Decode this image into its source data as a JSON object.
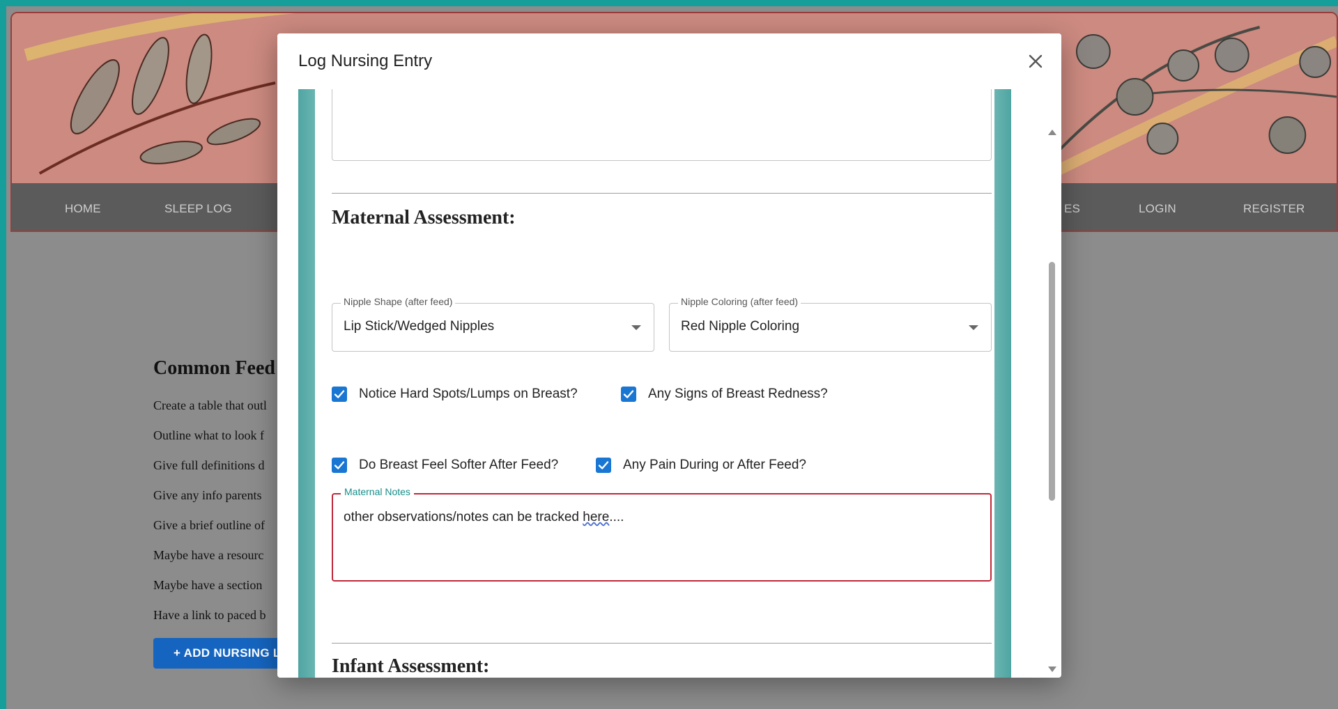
{
  "nav": {
    "items": [
      {
        "label": "HOME"
      },
      {
        "label": "SLEEP LOG"
      },
      {
        "label": "ES"
      },
      {
        "label": "LOGIN"
      },
      {
        "label": "REGISTER"
      }
    ]
  },
  "background_content": {
    "heading": "Common Feed",
    "lines": [
      "Create a table that outl",
      "Outline what to look f",
      "Give full definitions d",
      "Give any info parents",
      "Give a brief outline of",
      "Maybe have a resourc",
      "Maybe have a section",
      "Have a link to paced b"
    ],
    "add_button": "+ ADD NURSING LO"
  },
  "modal": {
    "title": "Log Nursing Entry",
    "maternal": {
      "title": "Maternal Assessment:",
      "nipple_shape": {
        "label": "Nipple Shape (after feed)",
        "value": "Lip Stick/Wedged Nipples"
      },
      "nipple_coloring": {
        "label": "Nipple Coloring (after feed)",
        "value": "Red Nipple Coloring"
      },
      "checkboxes": [
        {
          "label": "Notice Hard Spots/Lumps on Breast?",
          "checked": true
        },
        {
          "label": "Any Signs of Breast Redness?",
          "checked": true
        },
        {
          "label": "Do Breast Feel Softer After Feed?",
          "checked": true
        },
        {
          "label": "Any Pain During or After Feed?",
          "checked": true
        }
      ],
      "notes": {
        "label": "Maternal Notes",
        "value_prefix": "other observations/notes can be tracked ",
        "value_spell": "here",
        "value_suffix": "...."
      }
    },
    "infant": {
      "title": "Infant Assessment:"
    }
  },
  "colors": {
    "accent_teal": "#159e9a",
    "checkbox_blue": "#1976d2",
    "error_border": "#c0283a",
    "button_blue": "#1565c0"
  }
}
